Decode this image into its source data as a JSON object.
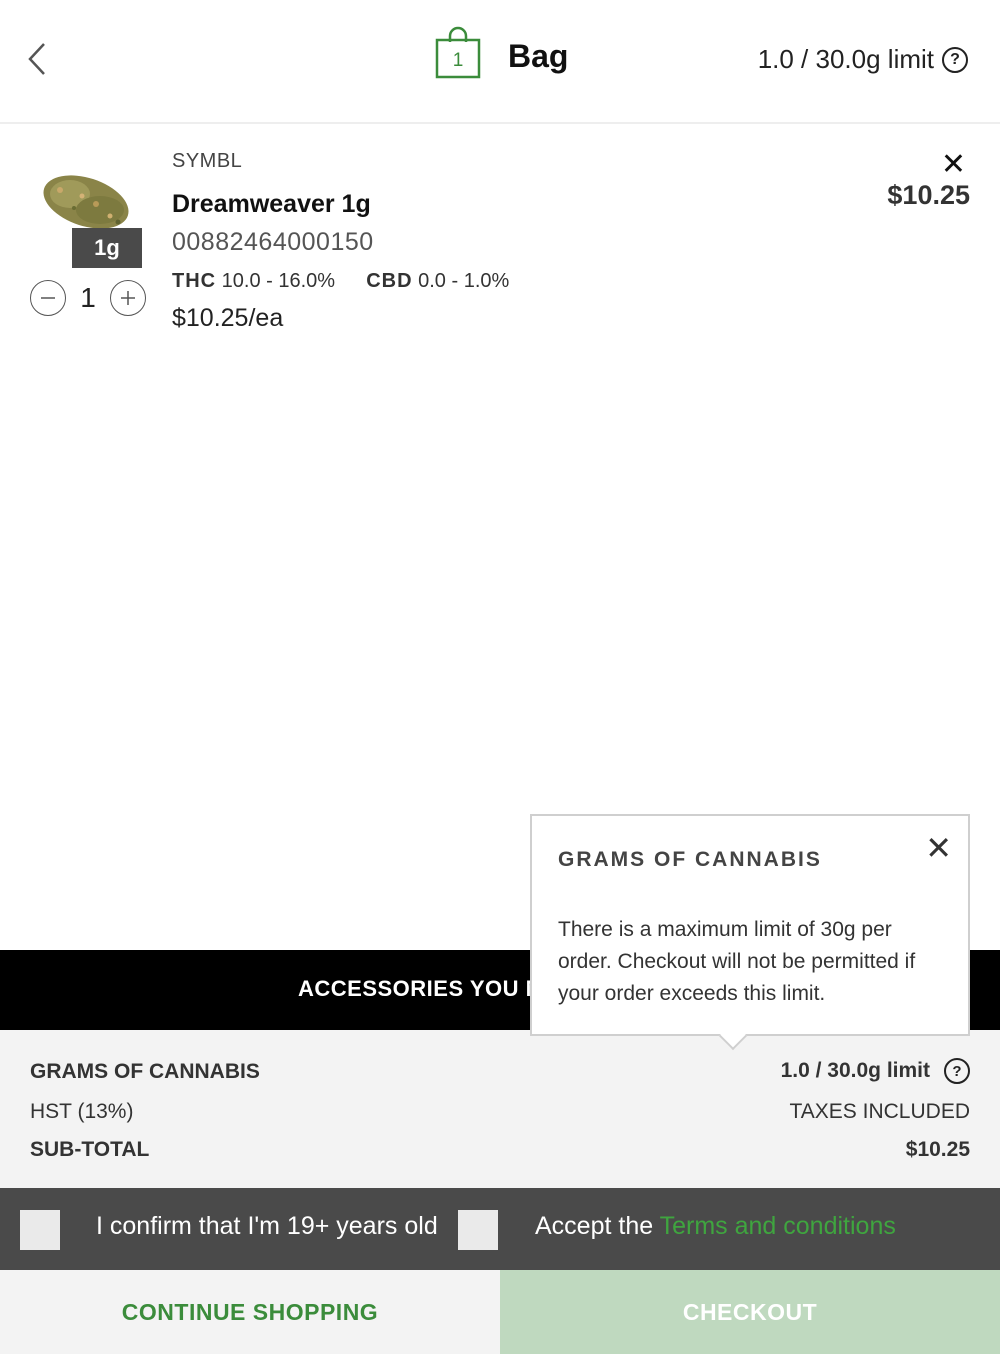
{
  "header": {
    "title": "Bag",
    "bag_count": "1",
    "limit_text": "1.0 / 30.0g limit",
    "help_glyph": "?",
    "accent_color": "#3b8c3b"
  },
  "item": {
    "brand": "SYMBL",
    "name": "Dreamweaver 1g",
    "sku": "00882464000150",
    "size_badge": "1g",
    "thc_label": "THC",
    "thc_value": "10.0 - 16.0%",
    "cbd_label": "CBD",
    "cbd_value": "0.0 - 1.0%",
    "unit_price": "$10.25/ea",
    "quantity": "1",
    "line_price": "$10.25",
    "remove_glyph": "✕"
  },
  "accessories": {
    "label": "ACCESSORIES YOU M"
  },
  "summary": {
    "grams_label": "GRAMS OF CANNABIS",
    "grams_value": "1.0 / 30.0g limit",
    "tax_label": "HST (13%)",
    "tax_value": "TAXES INCLUDED",
    "subtotal_label": "SUB-TOTAL",
    "subtotal_value": "$10.25"
  },
  "confirm": {
    "age_text": "I confirm that I'm 19+ years old",
    "accept_prefix": "Accept the ",
    "terms_link": "Terms and conditions"
  },
  "buttons": {
    "continue": "CONTINUE SHOPPING",
    "checkout": "CHECKOUT"
  },
  "tooltip": {
    "title": "GRAMS OF CANNABIS",
    "body": "There is a maximum limit of 30g per order. Checkout will not be permitted if your order exceeds this limit.",
    "close_glyph": "✕"
  }
}
